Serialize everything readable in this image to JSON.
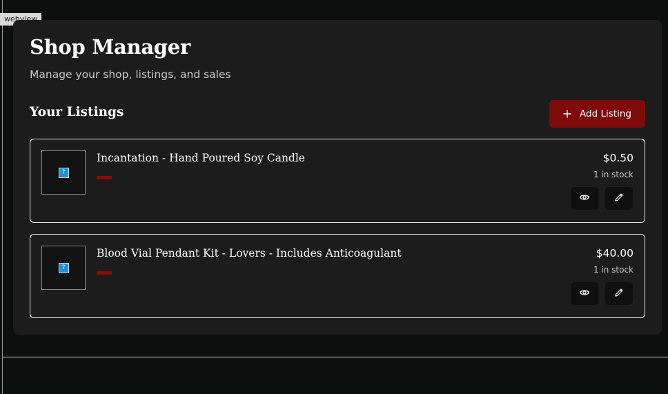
{
  "webview_label": "webview",
  "header": {
    "title": "Shop Manager",
    "subtitle": "Manage your shop, listings, and sales"
  },
  "listings_section": {
    "title": "Your Listings",
    "add_button_label": "Add Listing"
  },
  "listings": [
    {
      "title": "Incantation - Hand Poured Soy Candle",
      "price": "$0.50",
      "stock": "1 in stock",
      "image_placeholder": "?"
    },
    {
      "title": "Blood Vial Pendant Kit - Lovers - Includes Anticoagulant",
      "price": "$40.00",
      "stock": "1 in stock",
      "image_placeholder": "?"
    }
  ],
  "icons": {
    "add": "plus-icon",
    "view": "eye-icon",
    "edit": "pencil-icon",
    "image": "broken-image-icon"
  },
  "colors": {
    "accent": "#7f0a0a",
    "panel": "#1c1c1c",
    "background": "#0d0f0f",
    "text": "#ffffff"
  }
}
